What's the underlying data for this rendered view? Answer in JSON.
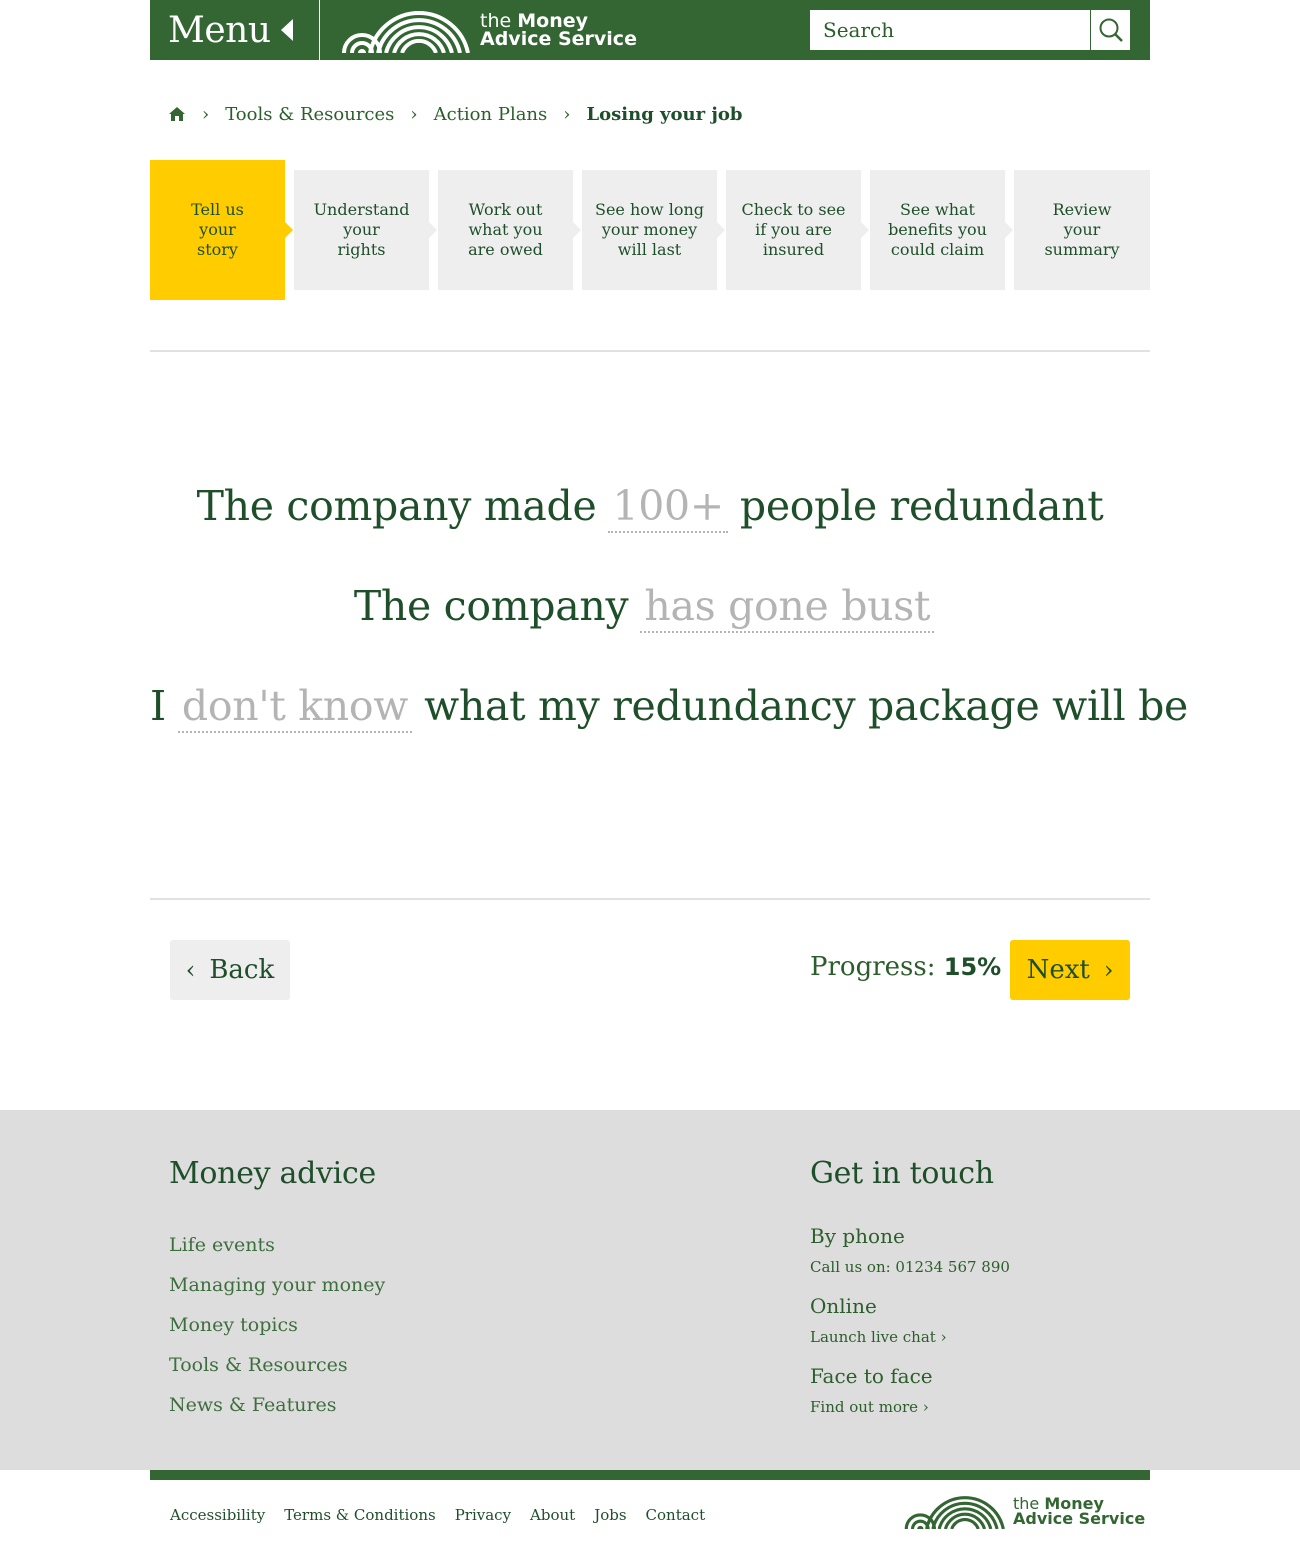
{
  "header": {
    "menu_label": "Menu",
    "logo_line1_prefix": "the",
    "logo_line1_bold": "Money",
    "logo_line2": "Advice Service",
    "search_placeholder": "Search"
  },
  "breadcrumb": {
    "items": [
      "Tools & Resources",
      "Action Plans"
    ],
    "current": "Losing your job"
  },
  "steps": [
    {
      "label": "Tell us your story",
      "lines": [
        "Tell us",
        "your",
        "story"
      ],
      "active": true
    },
    {
      "label": "Understand your rights",
      "lines": [
        "Understand",
        "your",
        "rights"
      ],
      "active": false
    },
    {
      "label": "Work out what you are owed",
      "lines": [
        "Work out",
        "what you",
        "are owed"
      ],
      "active": false
    },
    {
      "label": "See how long your money will last",
      "lines": [
        "See how long",
        "your money",
        "will last"
      ],
      "active": false
    },
    {
      "label": "Check to see if you are insured",
      "lines": [
        "Check to see",
        "if you are",
        "insured"
      ],
      "active": false
    },
    {
      "label": "See what benefits you could claim",
      "lines": [
        "See what",
        "benefits you",
        "could claim"
      ],
      "active": false
    },
    {
      "label": "Review your summary",
      "lines": [
        "Review",
        "your",
        "summary"
      ],
      "active": false
    }
  ],
  "story": {
    "s1_before": "The company made",
    "s1_value": "100+",
    "s1_after": "people redundant",
    "s2_before": "The company",
    "s2_value": "has gone bust",
    "s3_before": "I",
    "s3_value": "don't know",
    "s3_after": "what my redundancy package will be"
  },
  "nav": {
    "back_label": "Back",
    "progress_label": "Progress:",
    "progress_value": "15%",
    "next_label": "Next"
  },
  "footer": {
    "money_advice_title": "Money advice",
    "money_advice_links": [
      "Life events",
      "Managing your money",
      "Money topics",
      "Tools & Resources",
      "News & Features"
    ],
    "get_in_touch_title": "Get in touch",
    "phone_head": "By phone",
    "phone_text": "Call us on: 01234 567 890",
    "online_head": "Online",
    "online_text": "Launch live chat ›",
    "face_head": "Face to face",
    "face_text": "Find out more ›",
    "legal_links": [
      "Accessibility",
      "Terms & Conditions",
      "Privacy",
      "About",
      "Jobs",
      "Contact"
    ]
  },
  "colors": {
    "brand_green": "#336633",
    "text_green": "#1f4f2a",
    "accent_yellow": "#ffcc00",
    "step_grey": "#eeeeee",
    "footer_grey": "#dddddd"
  },
  "icons": {
    "menu": "triangle-left-icon",
    "search": "search-icon",
    "home": "home-icon",
    "back": "chevron-left-icon",
    "next": "chevron-right-icon",
    "logo": "rainbow-arcs-logo"
  }
}
